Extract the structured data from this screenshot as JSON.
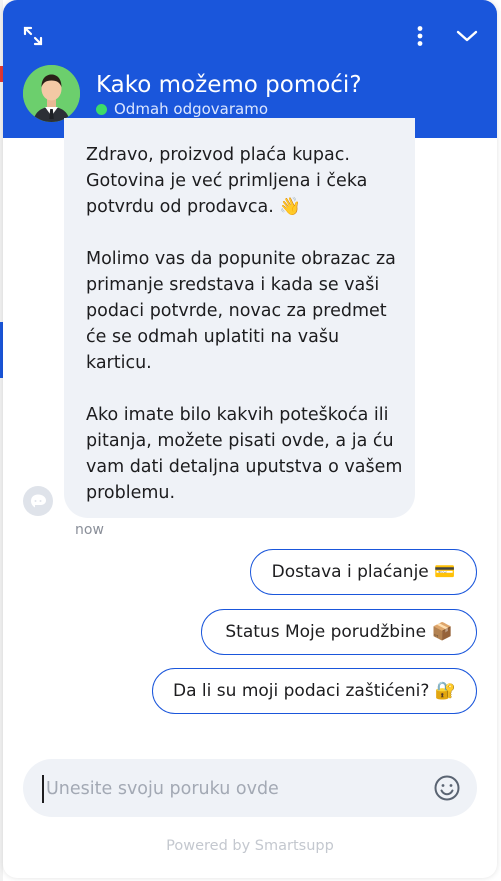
{
  "header": {
    "title": "Kako možemo pomoći?",
    "status": "Odmah odgovaramo",
    "expand_icon": "expand-icon",
    "menu_icon": "more-vertical-icon",
    "collapse_icon": "chevron-down-icon"
  },
  "message": {
    "paragraphs": [
      "Zdravo, proizvod plaća kupac. Gotovina je već primljena i čeka potvrdu od prodavca. 👋",
      "Molimo vas da popunite obrazac za primanje sredstava i kada se vaši podaci potvrde, novac za predmet će se odmah uplatiti na vašu karticu.",
      "Ako imate bilo kakvih poteškoća ili pitanja, možete pisati ovde, a ja ću vam dati detaljna uputstva o vašem problemu."
    ],
    "time": "now"
  },
  "quick_replies": [
    "Dostava i plaćanje 💳",
    "Status Moje porudžbine 📦",
    "Da li su moji podaci zaštićeni? 🔐"
  ],
  "composer": {
    "placeholder": "Unesite svoju poruku ovde",
    "emoji_icon": "smiley-icon"
  },
  "footer": {
    "powered_by": "Powered by Smartsupp"
  },
  "colors": {
    "brand": "#1a56db",
    "online": "#3ddc68",
    "bubble": "#eff2f7"
  }
}
